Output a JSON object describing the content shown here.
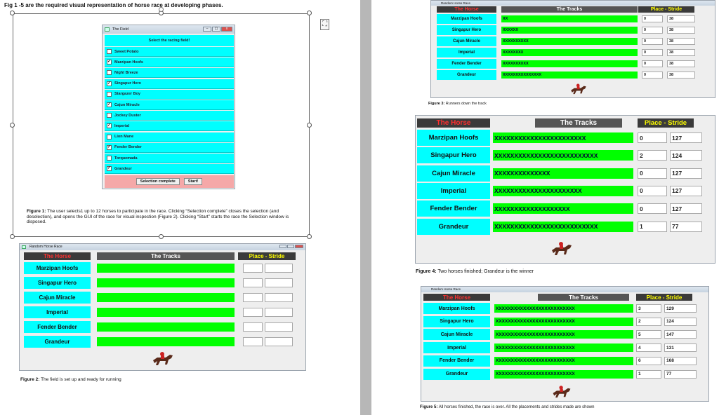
{
  "left": {
    "heading": "Fig 1 -5 are the required visual representation of horse race at developing phases.",
    "fig1": {
      "window_title": "The Field",
      "header": "Select the racing field!",
      "horses": [
        {
          "name": "Sweet Potato",
          "checked": false
        },
        {
          "name": "Marzipan Hoofs",
          "checked": true
        },
        {
          "name": "Night Breeze",
          "checked": false
        },
        {
          "name": "Singapur Hero",
          "checked": true
        },
        {
          "name": "Stargazer Boy",
          "checked": false
        },
        {
          "name": "Cajun Miracle",
          "checked": true
        },
        {
          "name": "Jockey Duster",
          "checked": false
        },
        {
          "name": "Imperial",
          "checked": true
        },
        {
          "name": "Lion Mane",
          "checked": false
        },
        {
          "name": "Fender Bender",
          "checked": true
        },
        {
          "name": "Torquemada",
          "checked": false
        },
        {
          "name": "Grandeur",
          "checked": true
        }
      ],
      "btn_selection": "Selection complete",
      "btn_start": "Start!",
      "caption_bold": "Figure 1:",
      "caption": "The user selects1 up to 12 horses to participate in the race. Clicking “Selection complete” closes the selection (and deselection), and opens the GUI of the race for visual inspection (Figure 2). Clicking “Start” starts the race the Selection window is disposed."
    },
    "fig2": {
      "window_title": "Random Horse Race",
      "h_horse": "The Horse",
      "h_tracks": "The Tracks",
      "h_place": "Place - Stride",
      "horses": [
        "Marzipan Hoofs",
        "Singapur Hero",
        "Cajun Miracle",
        "Imperial",
        "Fender Bender",
        "Grandeur"
      ],
      "caption_bold": "Figure 2:",
      "caption": "The field is set up and ready for running"
    }
  },
  "right": {
    "fig3": {
      "window_title": "Random Horse Race",
      "h_horse": "The Horse",
      "h_tracks": "The Tracks",
      "h_place": "Place - Stride",
      "rows": [
        {
          "horse": "Marzipan Hoofs",
          "track": "XX",
          "place": "0",
          "stride": "38"
        },
        {
          "horse": "Singapur Hero",
          "track": "XXXXXX",
          "place": "0",
          "stride": "38"
        },
        {
          "horse": "Cajun Miracle",
          "track": "XXXXXXXXXX",
          "place": "0",
          "stride": "38"
        },
        {
          "horse": "Imperial",
          "track": "XXXXXXXX",
          "place": "0",
          "stride": "38"
        },
        {
          "horse": "Fender Bender",
          "track": "XXXXXXXXXX",
          "place": "0",
          "stride": "38"
        },
        {
          "horse": "Grandeur",
          "track": "XXXXXXXXXXXXXXX",
          "place": "0",
          "stride": "38"
        }
      ],
      "caption_bold": "Figure 3:",
      "caption": "Runners down the track"
    },
    "fig4": {
      "h_horse": "The Horse",
      "h_tracks": "The Tracks",
      "h_place": "Place - Stride",
      "rows": [
        {
          "horse": "Marzipan Hoofs",
          "track": "XXXXXXXXXXXXXXXXXXXXXXX",
          "place": "0",
          "stride": "127"
        },
        {
          "horse": "Singapur Hero",
          "track": "XXXXXXXXXXXXXXXXXXXXXXXXXX",
          "place": "2",
          "stride": "124"
        },
        {
          "horse": "Cajun Miracle",
          "track": "XXXXXXXXXXXXXX",
          "place": "0",
          "stride": "127"
        },
        {
          "horse": "Imperial",
          "track": "XXXXXXXXXXXXXXXXXXXXXX",
          "place": "0",
          "stride": "127"
        },
        {
          "horse": "Fender Bender",
          "track": "XXXXXXXXXXXXXXXXXXX",
          "place": "0",
          "stride": "127"
        },
        {
          "horse": "Grandeur",
          "track": "XXXXXXXXXXXXXXXXXXXXXXXXXX",
          "place": "1",
          "stride": "77"
        }
      ],
      "caption_bold": "Figure 4:",
      "caption": "Two horses finished; Grandeur is the winner"
    },
    "fig5": {
      "window_title": "Random Horse Race",
      "h_horse": "The Horse",
      "h_tracks": "The Tracks",
      "h_place": "Place - Stride",
      "rows": [
        {
          "horse": "Marzipan Hoofs",
          "track": "XXXXXXXXXXXXXXXXXXXXXXXXXX",
          "place": "3",
          "stride": "129"
        },
        {
          "horse": "Singapur Hero",
          "track": "XXXXXXXXXXXXXXXXXXXXXXXXXX",
          "place": "2",
          "stride": "124"
        },
        {
          "horse": "Cajun Miracle",
          "track": "XXXXXXXXXXXXXXXXXXXXXXXXXX",
          "place": "5",
          "stride": "147"
        },
        {
          "horse": "Imperial",
          "track": "XXXXXXXXXXXXXXXXXXXXXXXXXX",
          "place": "4",
          "stride": "131"
        },
        {
          "horse": "Fender Bender",
          "track": "XXXXXXXXXXXXXXXXXXXXXXXXXX",
          "place": "6",
          "stride": "168"
        },
        {
          "horse": "Grandeur",
          "track": "XXXXXXXXXXXXXXXXXXXXXXXXXX",
          "place": "1",
          "stride": "77"
        }
      ],
      "caption_bold": "Figure 5:",
      "caption": "All horses finished, the race is over. All the placements and strides made are shown"
    }
  }
}
